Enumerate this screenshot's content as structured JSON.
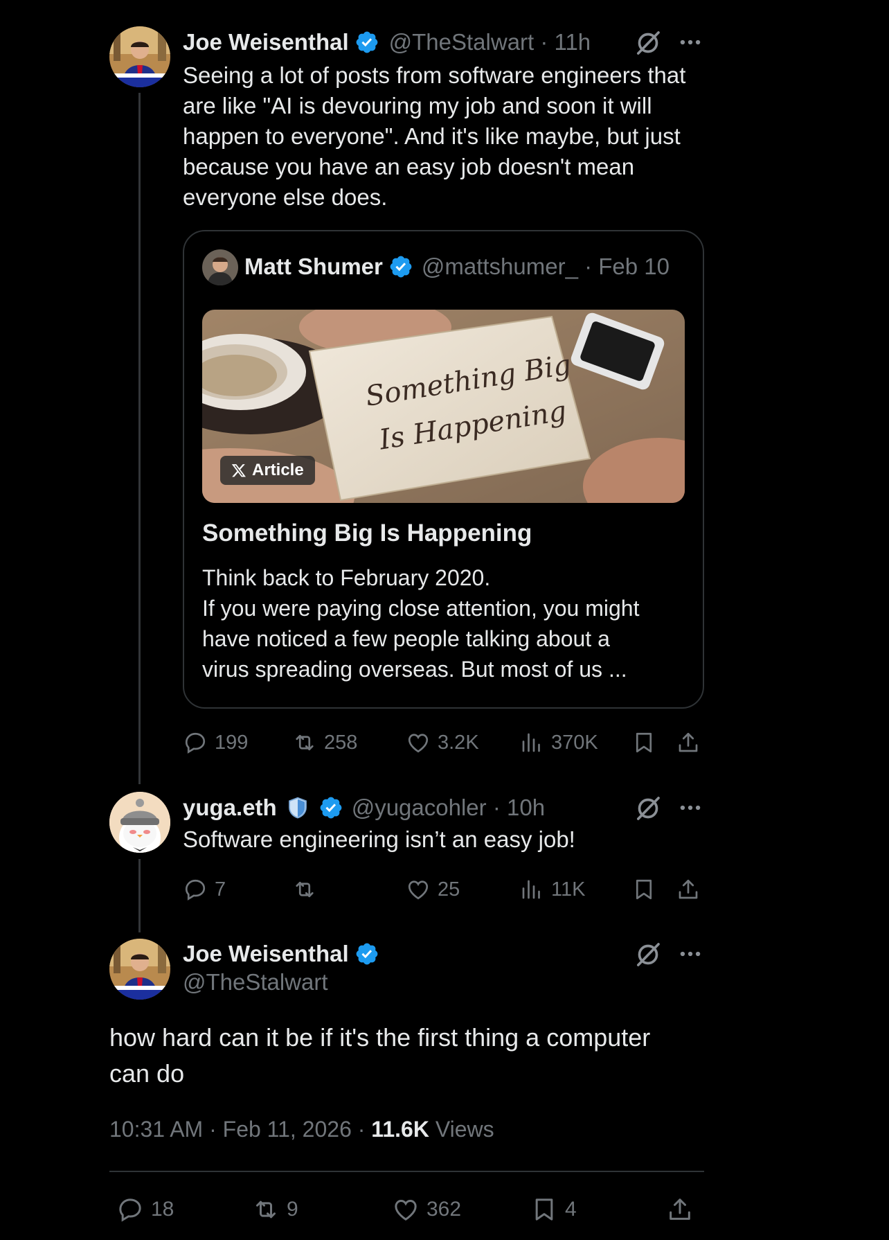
{
  "tweet1": {
    "name": "Joe Weisenthal",
    "handle": "@TheStalwart",
    "time": "11h",
    "avatar_caption": "THE CULTURE OF REDIST",
    "lines": [
      "Seeing a lot of posts from software engineers that",
      "are like \"AI is devouring my job and soon it will",
      "happen to everyone\". And it's like maybe, but just",
      "because you have an easy job doesn't mean",
      "everyone else does."
    ],
    "quote": {
      "name": "Matt Shumer",
      "handle": "@mattshumer_",
      "date": "Feb 10",
      "badge": "Article",
      "note_line1": "Something Big",
      "note_line2": "Is Happening",
      "title": "Something Big Is Happening",
      "lines": [
        "Think back to February 2020.",
        "If you were paying close attention, you might",
        "have noticed a few people talking about a",
        "virus spreading overseas. But most of us ..."
      ]
    },
    "stats": {
      "replies": "199",
      "reposts": "258",
      "likes": "3.2K",
      "views": "370K"
    }
  },
  "tweet2": {
    "name": "yuga.eth",
    "handle": "@yugacohler",
    "time": "10h",
    "text": "Software engineering isn’t an easy job!",
    "stats": {
      "replies": "7",
      "reposts": "",
      "likes": "25",
      "views": "11K"
    }
  },
  "main": {
    "name": "Joe Weisenthal",
    "handle": "@TheStalwart",
    "avatar_caption": "THE CULTURE OF REDIST",
    "lines": [
      "how hard can it be if it's the first thing a computer",
      "can do"
    ],
    "time": "10:31 AM",
    "date": "Feb 11, 2026",
    "views_count": "11.6K",
    "views_label": "Views",
    "stats": {
      "replies": "18",
      "reposts": "9",
      "likes": "362",
      "bookmarks": "4"
    }
  },
  "colors": {
    "background": "#000000",
    "text": "#e7e9ea",
    "muted": "#71767b",
    "verified": "#1d9bf0",
    "border": "#2f3336"
  },
  "icons": [
    "grok-icon",
    "more-icon",
    "reply-icon",
    "repost-icon",
    "like-icon",
    "views-icon",
    "bookmark-icon",
    "share-icon",
    "verified-icon",
    "shield-icon",
    "x-logo-icon"
  ]
}
